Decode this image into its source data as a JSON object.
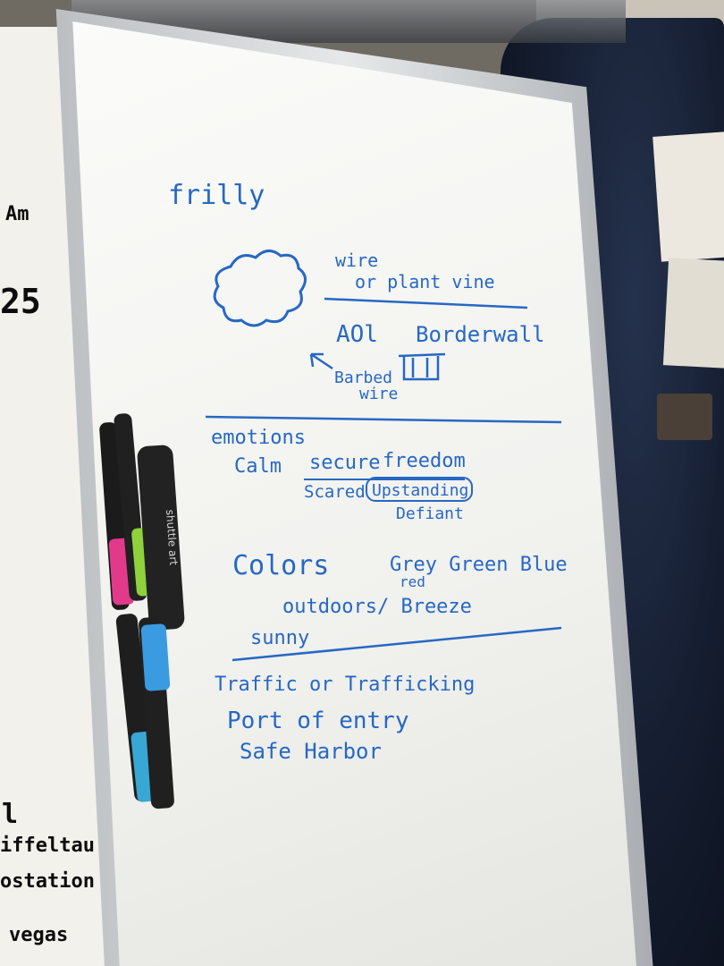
{
  "board": {
    "frilly": "frilly",
    "wire": "wire",
    "plant_vine": "or plant vine",
    "aol": "AOl",
    "borderwall": "Borderwall",
    "barbed": "Barbed",
    "barbed_wire": "wire",
    "emotions": "emotions",
    "calm": "Calm",
    "secure": "secure",
    "freedom": "freedom",
    "scared": "Scared",
    "upstanding": "Upstanding",
    "defiant": "Defiant",
    "colors": "Colors",
    "color_list": "Grey Green Blue",
    "red": "red",
    "outdoors": "outdoors/ Breeze",
    "sunny": "sunny",
    "traffic": "Traffic or Trafficking",
    "port": "Port of entry",
    "harbor": "Safe Harbor"
  },
  "marker_brand": "shuttle art",
  "left_board": {
    "line1": "Am",
    "line2": "25",
    "line3": "l",
    "line4": "iffeltau",
    "line5": "ostation",
    "line6": "vegas"
  }
}
